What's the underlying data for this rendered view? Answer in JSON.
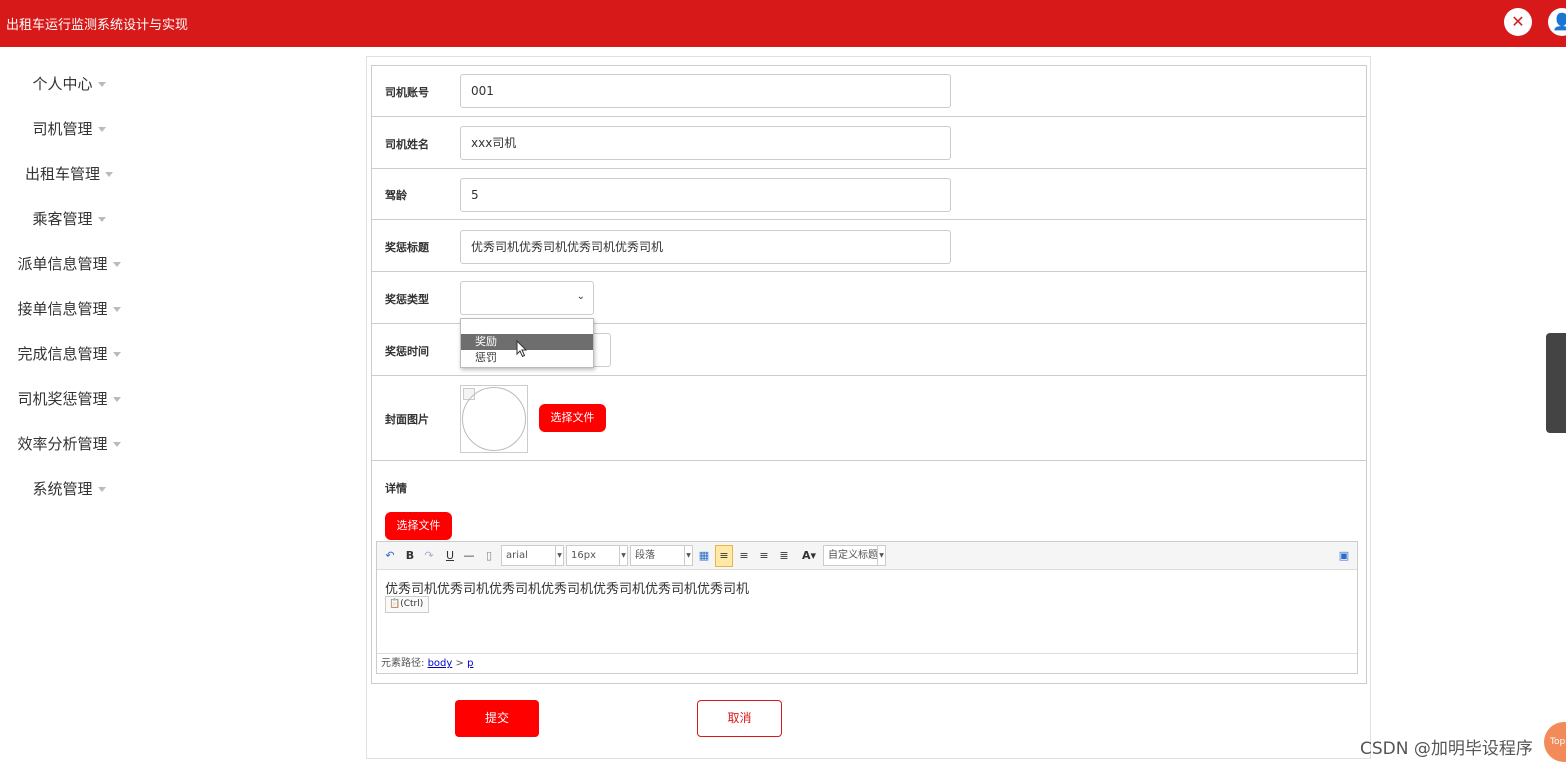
{
  "header": {
    "title": "出租车运行监测系统设计与实现",
    "close_icon": "close-icon",
    "user_icon": "user-icon",
    "accent": "#d71919"
  },
  "sidebar": {
    "items": [
      {
        "label": "个人中心"
      },
      {
        "label": "司机管理"
      },
      {
        "label": "出租车管理"
      },
      {
        "label": "乘客管理"
      },
      {
        "label": "派单信息管理"
      },
      {
        "label": "接单信息管理"
      },
      {
        "label": "完成信息管理"
      },
      {
        "label": "司机奖惩管理"
      },
      {
        "label": "效率分析管理"
      },
      {
        "label": "系统管理"
      }
    ]
  },
  "form": {
    "driver_account": {
      "label": "司机账号",
      "value": "001"
    },
    "driver_name": {
      "label": "司机姓名",
      "value": "xxx司机"
    },
    "driving_years": {
      "label": "驾龄",
      "value": "5"
    },
    "title": {
      "label": "奖惩标题",
      "value": "优秀司机优秀司机优秀司机优秀司机"
    },
    "type": {
      "label": "奖惩类型",
      "value": "",
      "options": [
        "奖励",
        "惩罚"
      ],
      "highlighted": "奖励"
    },
    "time": {
      "label": "奖惩时间",
      "value": ""
    },
    "cover": {
      "label": "封面图片",
      "choose_label": "选择文件"
    },
    "details": {
      "label": "详情",
      "choose_label": "选择文件"
    }
  },
  "editor": {
    "font": "arial",
    "size": "16px",
    "paragraph": "段落",
    "custom_title": "自定义标题",
    "content": "优秀司机优秀司机优秀司机优秀司机优秀司机优秀司机优秀司机",
    "paste_hint": "(Ctrl)",
    "path_label": "元素路径:",
    "path_body": "body",
    "path_sep": ">",
    "path_p": "p"
  },
  "actions": {
    "submit": "提交",
    "cancel": "取消"
  },
  "watermark": "CSDN @加明毕设程序",
  "top_button": "Top"
}
